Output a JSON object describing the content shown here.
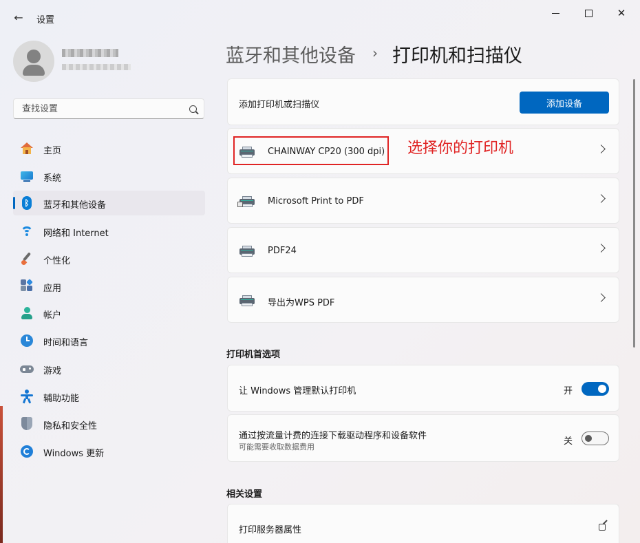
{
  "window": {
    "title": "设置",
    "back_icon": "←",
    "close_icon": "✕"
  },
  "search": {
    "placeholder": "查找设置"
  },
  "sidebar": {
    "items": [
      {
        "label": "主页",
        "icon": "home-icon"
      },
      {
        "label": "系统",
        "icon": "system-icon"
      },
      {
        "label": "蓝牙和其他设备",
        "icon": "bluetooth-icon",
        "active": true,
        "glyph": "ᛒ"
      },
      {
        "label": "网络和 Internet",
        "icon": "wifi-icon"
      },
      {
        "label": "个性化",
        "icon": "brush-icon"
      },
      {
        "label": "应用",
        "icon": "apps-icon"
      },
      {
        "label": "帐户",
        "icon": "account-icon"
      },
      {
        "label": "时间和语言",
        "icon": "clock-icon"
      },
      {
        "label": "游戏",
        "icon": "gamepad-icon"
      },
      {
        "label": "辅助功能",
        "icon": "accessibility-icon"
      },
      {
        "label": "隐私和安全性",
        "icon": "shield-icon"
      },
      {
        "label": "Windows 更新",
        "icon": "update-icon"
      }
    ]
  },
  "breadcrumb": {
    "parent": "蓝牙和其他设备",
    "separator": "›",
    "current": "打印机和扫描仪"
  },
  "add_device": {
    "label": "添加打印机或扫描仪",
    "button": "添加设备"
  },
  "printers": [
    {
      "name": "CHAINWAY CP20 (300 dpi)"
    },
    {
      "name": "Microsoft Print to PDF"
    },
    {
      "name": "PDF24"
    },
    {
      "name": "导出为WPS PDF"
    }
  ],
  "annotation": {
    "text": "选择你的打印机",
    "color": "#e02424"
  },
  "preferences": {
    "title": "打印机首选项",
    "manage_default": {
      "label": "让 Windows 管理默认打印机",
      "state": "开",
      "on": true
    },
    "metered": {
      "label": "通过按流量计费的连接下载驱动程序和设备软件",
      "sublabel": "可能需要收取数据费用",
      "state": "关",
      "on": false
    }
  },
  "related": {
    "title": "相关设置",
    "print_server": {
      "label": "打印服务器属性"
    }
  },
  "colors": {
    "accent": "#0067c0"
  }
}
